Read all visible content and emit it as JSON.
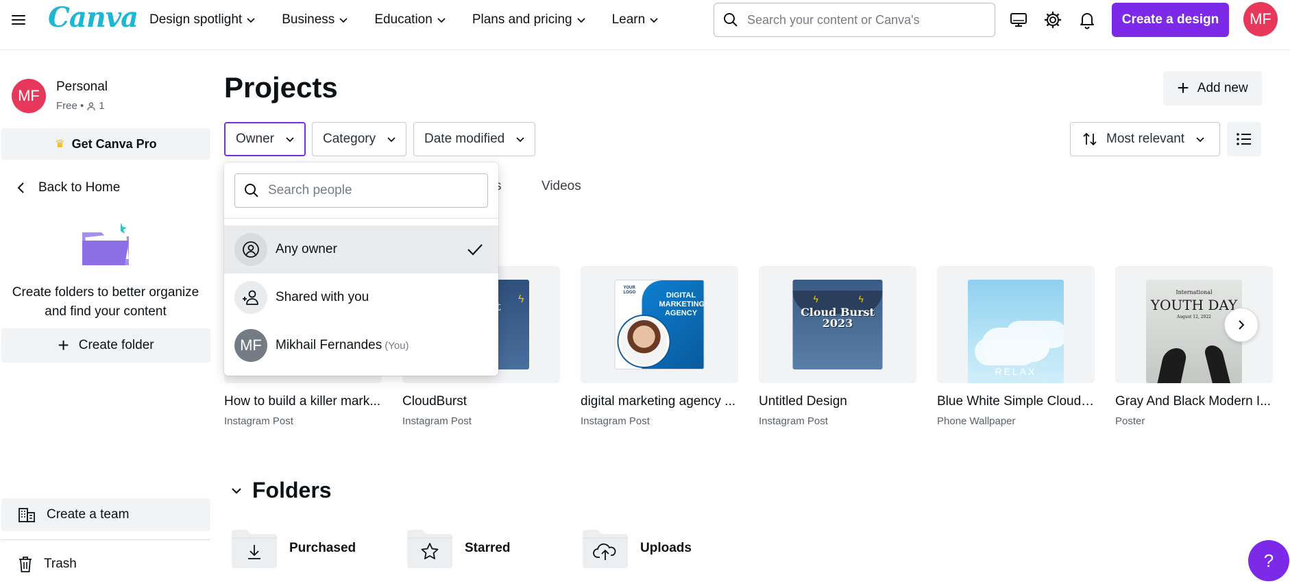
{
  "header": {
    "logo": "Canva",
    "nav": [
      {
        "label": "Design spotlight"
      },
      {
        "label": "Business"
      },
      {
        "label": "Education"
      },
      {
        "label": "Plans and pricing"
      },
      {
        "label": "Learn"
      }
    ],
    "search_placeholder": "Search your content or Canva's",
    "create_label": "Create a design",
    "avatar_initials": "MF",
    "accent_color": "#7d2ae8"
  },
  "sidebar": {
    "avatar_initials": "MF",
    "profile_name": "Personal",
    "profile_plan": "Free •",
    "profile_members": "1",
    "pro_label": "Get Canva Pro",
    "back_label": "Back to Home",
    "folder_prompt_line1": "Create folders to better organize",
    "folder_prompt_line2": "and find your content",
    "create_folder_label": "Create folder",
    "create_team_label": "Create a team",
    "trash_label": "Trash"
  },
  "main": {
    "title": "Projects",
    "add_new_label": "Add new",
    "filters": [
      {
        "label": "Owner"
      },
      {
        "label": "Category"
      },
      {
        "label": "Date modified"
      }
    ],
    "sort_label": "Most relevant",
    "tabs": {
      "partial": "s",
      "videos": "Videos"
    },
    "designs": [
      {
        "title": "How to build a killer mark...",
        "type": "Instagram Post"
      },
      {
        "title": "CloudBurst",
        "type": "Instagram Post"
      },
      {
        "title": "digital marketing agency ...",
        "type": "Instagram Post"
      },
      {
        "title": "Untitled Design",
        "type": "Instagram Post"
      },
      {
        "title": "Blue White Simple Cloud ...",
        "type": "Phone Wallpaper"
      },
      {
        "title": "Gray And Black Modern I...",
        "type": "Poster"
      }
    ],
    "art": {
      "cloudburst_title": "Cloud Burst",
      "cloudburst_year": "2023",
      "dm_logo": "YOUR LOGO",
      "dm_line1": "DIGITAL",
      "dm_line2": "MARKETING",
      "dm_line3": "AGENCY",
      "relax": "RELAX",
      "youth_intl": "International",
      "youth_title": "YOUTH DAY",
      "youth_date": "August 12, 2022"
    },
    "folders_heading": "Folders",
    "folders": [
      {
        "label": "Purchased"
      },
      {
        "label": "Starred"
      },
      {
        "label": "Uploads"
      }
    ]
  },
  "dropdown": {
    "search_placeholder": "Search people",
    "items": [
      {
        "label": "Any owner",
        "selected": true
      },
      {
        "label": "Shared with you",
        "selected": false
      },
      {
        "label": "Mikhail Fernandes",
        "suffix": "(You)",
        "initials": "MF",
        "selected": false
      }
    ]
  },
  "help_label": "?"
}
